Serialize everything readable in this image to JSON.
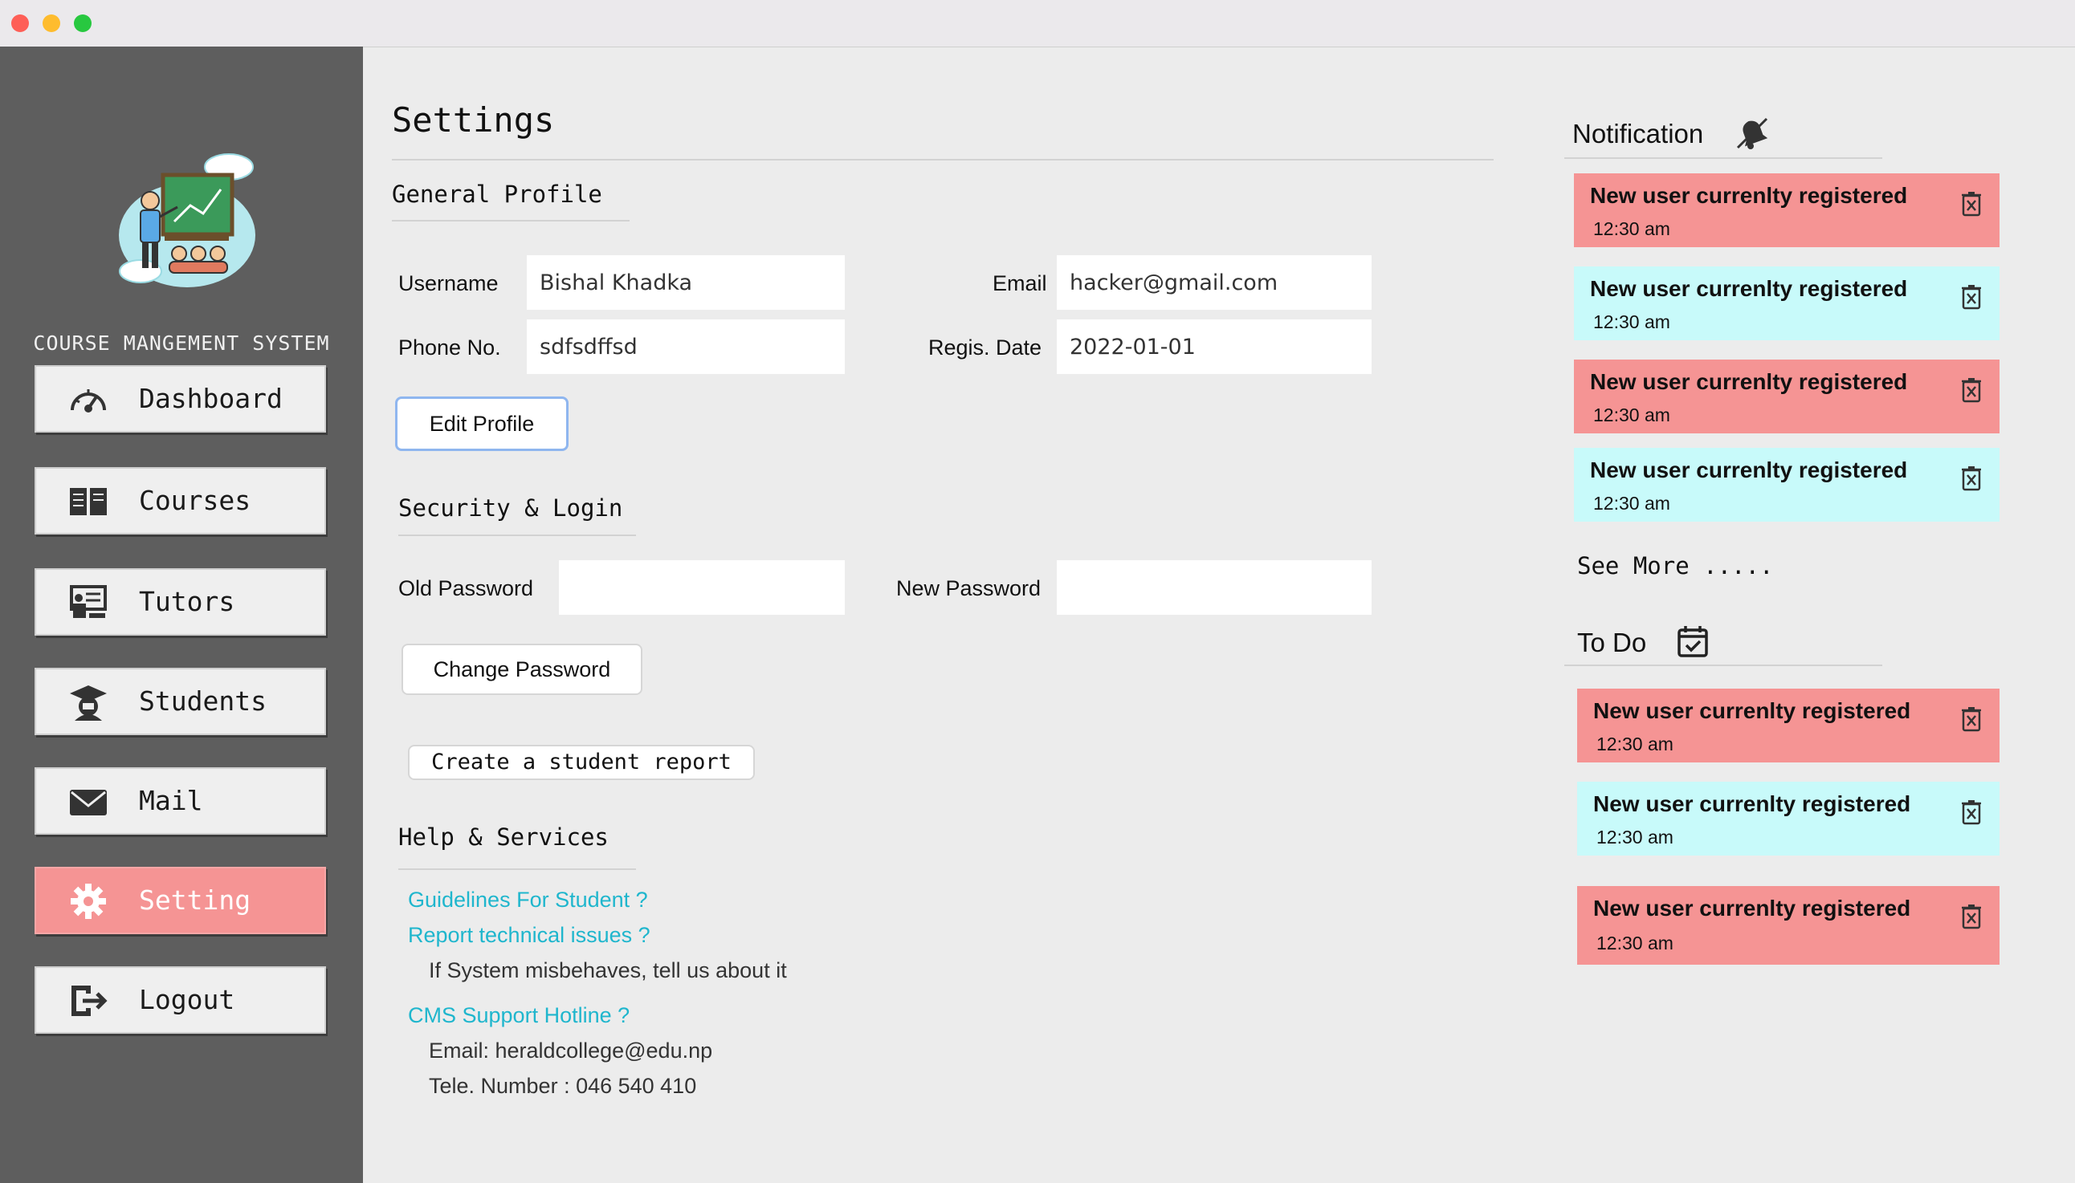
{
  "app": {
    "name": "COURSE MANGEMENT SYSTEM"
  },
  "sidebar": {
    "items": [
      {
        "label": "Dashboard",
        "icon": "speedometer-icon"
      },
      {
        "label": "Courses",
        "icon": "book-icon"
      },
      {
        "label": "Tutors",
        "icon": "tutor-board-icon"
      },
      {
        "label": "Students",
        "icon": "graduate-icon"
      },
      {
        "label": "Mail",
        "icon": "envelope-icon"
      },
      {
        "label": "Setting",
        "icon": "gear-icon",
        "active": true
      },
      {
        "label": "Logout",
        "icon": "logout-icon"
      }
    ]
  },
  "settings": {
    "title": "Settings",
    "general": {
      "title": "General Profile",
      "username_label": "Username",
      "username_value": "Bishal Khadka",
      "email_label": "Email",
      "email_value": "hacker@gmail.com",
      "phone_label": "Phone No.",
      "phone_value": "sdfsdffsd",
      "regis_label": "Regis. Date",
      "regis_value": "2022-01-01",
      "edit_button": "Edit Profile"
    },
    "security": {
      "title": "Security & Login",
      "old_label": "Old Password",
      "new_label": "New Password",
      "change_button": "Change Password",
      "report_button": "Create a student report"
    },
    "help": {
      "title": "Help & Services",
      "guidelines": "Guidelines For Student ?",
      "report": "Report technical issues ?",
      "report_info": "If System misbehaves, tell us about it",
      "hotline": "CMS Support Hotline ?",
      "hotline_email": "Email: heraldcollege@edu.np",
      "hotline_phone": "Tele. Number : 046 540 410"
    }
  },
  "notifications": {
    "title": "Notification",
    "see_more": "See More .....",
    "items": [
      {
        "text": "New user currenlty registered",
        "time": "12:30 am",
        "color": "#f59494"
      },
      {
        "text": "New user currenlty registered",
        "time": "12:30 am",
        "color": "#c8fafa"
      },
      {
        "text": "New user currenlty registered",
        "time": "12:30 am",
        "color": "#f59494"
      },
      {
        "text": "New user currenlty registered",
        "time": "12:30 am",
        "color": "#c8fafa"
      }
    ]
  },
  "todo": {
    "title": "To Do",
    "items": [
      {
        "text": "New user currenlty registered",
        "time": "12:30 am",
        "color": "#f59494"
      },
      {
        "text": "New user currenlty registered",
        "time": "12:30 am",
        "color": "#c8fafa"
      },
      {
        "text": "New user currenlty registered",
        "time": "12:30 am",
        "color": "#f59494"
      }
    ]
  }
}
